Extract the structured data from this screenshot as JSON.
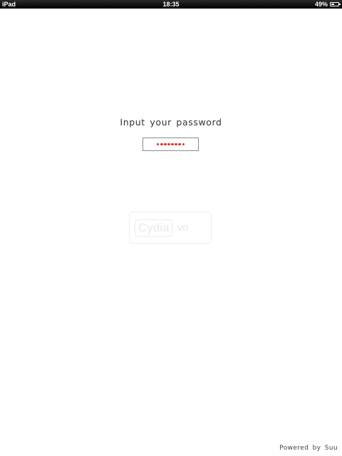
{
  "status_bar": {
    "device": "iPad",
    "time": "18:35",
    "battery_percent_label": "49%",
    "battery_level": 0.49
  },
  "prompt": {
    "label": "Input your password"
  },
  "password_field": {
    "masked_length": 8,
    "dot_color": "#d9342b"
  },
  "watermark": {
    "main": "Cydia",
    "suffix": ".vn"
  },
  "footer": {
    "credit": "Powered by Suu"
  }
}
